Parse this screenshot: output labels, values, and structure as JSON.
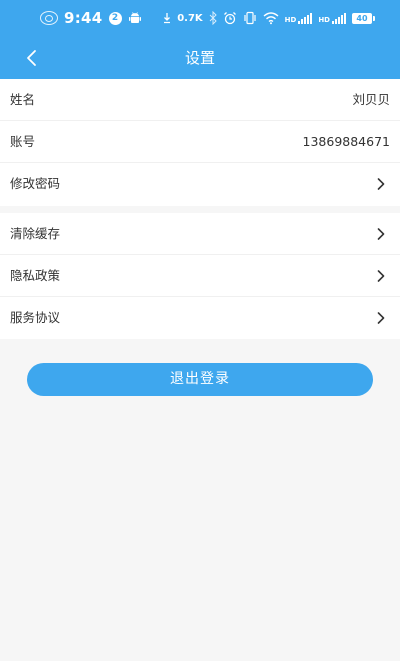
{
  "status_bar": {
    "time": "9:44",
    "notification_count": "2",
    "net_speed": "0.7K",
    "signal_tag_1": "HD",
    "signal_tag_2": "HD",
    "battery": "40"
  },
  "header": {
    "title": "设置",
    "background_color": "#3ea7ee"
  },
  "profile_group": {
    "name_label": "姓名",
    "name_value": "刘贝贝",
    "account_label": "账号",
    "account_value": "13869884671",
    "change_password_label": "修改密码"
  },
  "settings_group": {
    "clear_cache_label": "清除缓存",
    "privacy_policy_label": "隐私政策",
    "service_agreement_label": "服务协议"
  },
  "logout_button": {
    "label": "退出登录",
    "color": "#3ea7ee"
  }
}
